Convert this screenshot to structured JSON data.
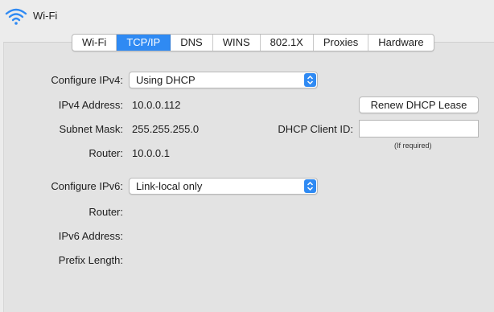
{
  "window": {
    "title": "Wi-Fi"
  },
  "tabs": [
    {
      "label": "Wi-Fi",
      "active": false
    },
    {
      "label": "TCP/IP",
      "active": true
    },
    {
      "label": "DNS",
      "active": false
    },
    {
      "label": "WINS",
      "active": false
    },
    {
      "label": "802.1X",
      "active": false
    },
    {
      "label": "Proxies",
      "active": false
    },
    {
      "label": "Hardware",
      "active": false
    }
  ],
  "ipv4": {
    "configure_label": "Configure IPv4:",
    "configure_value": "Using DHCP",
    "address_label": "IPv4 Address:",
    "address_value": "10.0.0.112",
    "subnet_label": "Subnet Mask:",
    "subnet_value": "255.255.255.0",
    "router_label": "Router:",
    "router_value": "10.0.0.1",
    "renew_button": "Renew DHCP Lease",
    "client_id_label": "DHCP Client ID:",
    "client_id_value": "",
    "client_id_hint": "(If required)"
  },
  "ipv6": {
    "configure_label": "Configure IPv6:",
    "configure_value": "Link-local only",
    "router_label": "Router:",
    "address_label": "IPv6 Address:",
    "prefix_label": "Prefix Length:"
  },
  "colors": {
    "accent": "#2f8af3",
    "background": "#ececec",
    "panel": "#e3e3e3"
  },
  "icons": {
    "title": "wifi-icon",
    "select_arrows": "chevron-updown-icon"
  }
}
